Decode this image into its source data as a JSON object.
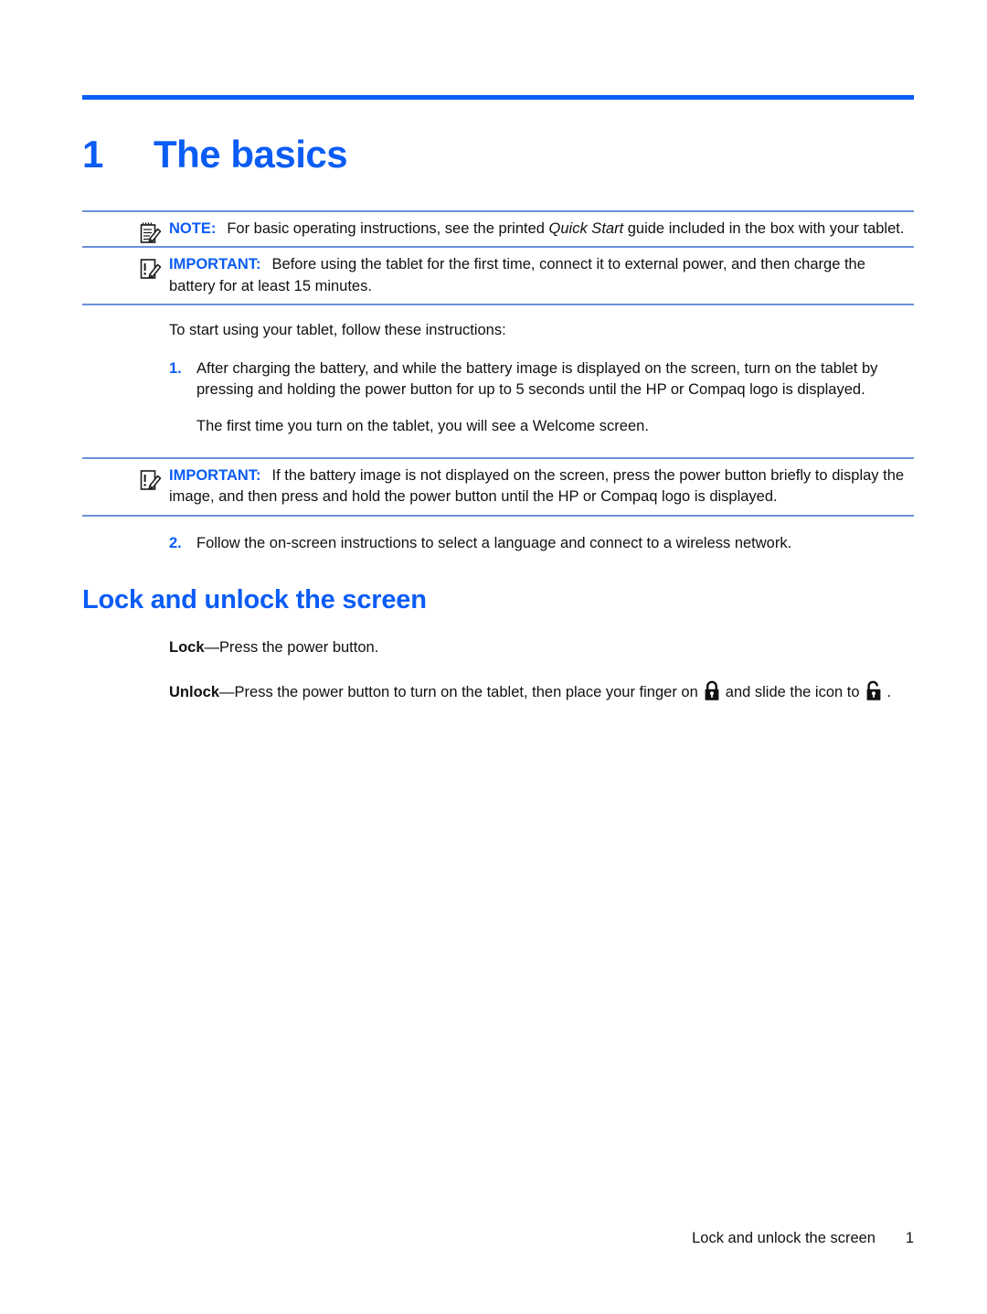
{
  "document": {
    "chapter_number": "1",
    "chapter_title": "The basics"
  },
  "callouts": {
    "note": {
      "label": "NOTE:",
      "icon": "note-pad-pencil-icon",
      "text_before_italic": "For basic operating instructions, see the printed ",
      "italic_text": "Quick Start",
      "text_after_italic": " guide included in the box with your tablet."
    },
    "important_1": {
      "label": "IMPORTANT:",
      "icon": "important-pad-pencil-icon",
      "text": "Before using the tablet for the first time, connect it to external power, and then charge the battery for at least 15 minutes."
    },
    "important_2": {
      "label": "IMPORTANT:",
      "icon": "important-pad-pencil-icon",
      "text": "If the battery image is not displayed on the screen, press the power button briefly to display the image, and then press and hold the power button until the HP or Compaq logo is displayed."
    }
  },
  "intro": {
    "lead_in": "To start using your tablet, follow these instructions:"
  },
  "steps": [
    {
      "marker": "1.",
      "text": "After charging the battery, and while the battery image is displayed on the screen, turn on the tablet by pressing and holding the power button for up to 5 seconds until the HP or Compaq logo is displayed.",
      "follow_up": "The first time you turn on the tablet, you will see a Welcome screen."
    },
    {
      "marker": "2.",
      "text": "Follow the on-screen instructions to select a language and connect to a wireless network."
    }
  ],
  "section": {
    "heading": "Lock and unlock the screen",
    "lock": {
      "term": "Lock",
      "text": "—Press the power button."
    },
    "unlock": {
      "term": "Unlock",
      "text_part_1": "—Press the power button to turn on the tablet, then place your finger on",
      "locked_icon": "padlock-closed-icon",
      "text_part_2": "and slide the icon to",
      "unlocked_icon": "padlock-open-icon",
      "text_part_3": "."
    }
  },
  "footer": {
    "running_head": "Lock and unlock the screen",
    "page_number": "1"
  },
  "colors": {
    "accent_blue": "#0a5cf5",
    "rule_blue": "#6d8fd8",
    "body_text": "#111111"
  }
}
